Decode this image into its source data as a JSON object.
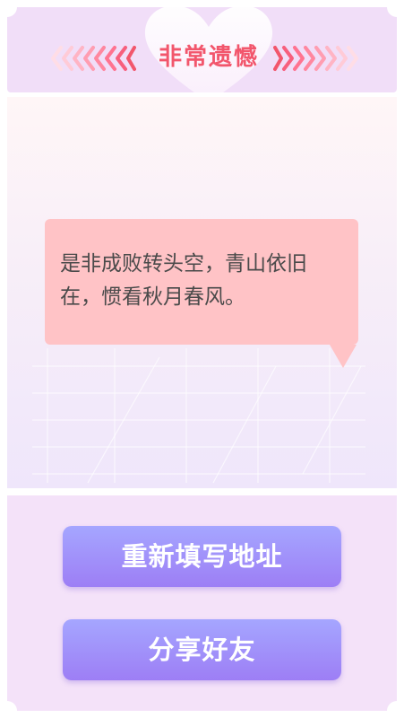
{
  "header": {
    "title": "非常遗憾",
    "left_icon": "chevrons-left-icon",
    "right_icon": "chevrons-right-icon",
    "badge_icon": "heart-icon"
  },
  "message": {
    "text": "是非成败转头空，青山依旧在，惯看秋月春风。"
  },
  "actions": {
    "refill_label": "重新填写地址",
    "share_label": "分享好友"
  },
  "colors": {
    "title": "#f2566c",
    "header_bg": "#f1def8",
    "bubble_bg": "#ffc3c6",
    "button_top": "#a5a6ff",
    "button_bottom": "#9d7ef5"
  }
}
